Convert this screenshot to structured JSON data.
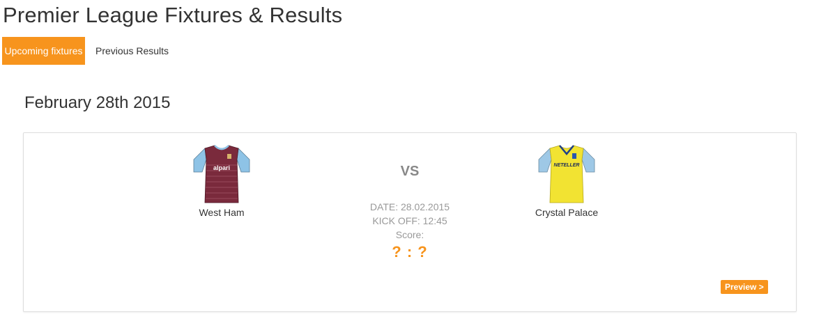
{
  "page": {
    "title": "Premier League Fixtures & Results"
  },
  "tabs": [
    {
      "label": "Upcoming fixtures",
      "active": true
    },
    {
      "label": "Previous Results",
      "active": false
    }
  ],
  "fixture_group": {
    "date_heading": "February 28th 2015"
  },
  "fixture": {
    "home_team": {
      "name": "West Ham",
      "kit_icon": "west-ham-shirt-icon",
      "kit_color": "#7a2a3c",
      "sleeve_color": "#8ec3e6"
    },
    "away_team": {
      "name": "Crystal Palace",
      "kit_icon": "crystal-palace-shirt-icon",
      "kit_color": "#f2e332",
      "sleeve_color": "#9ec8e6"
    },
    "vs_label": "VS",
    "date_text": "DATE: 28.02.2015",
    "kickoff_text": "KICK OFF: 12:45",
    "score_label": "Score:",
    "score_value": "? : ?",
    "preview_label": "Preview >"
  },
  "colors": {
    "accent": "#f7941d",
    "muted_text": "#999999"
  }
}
